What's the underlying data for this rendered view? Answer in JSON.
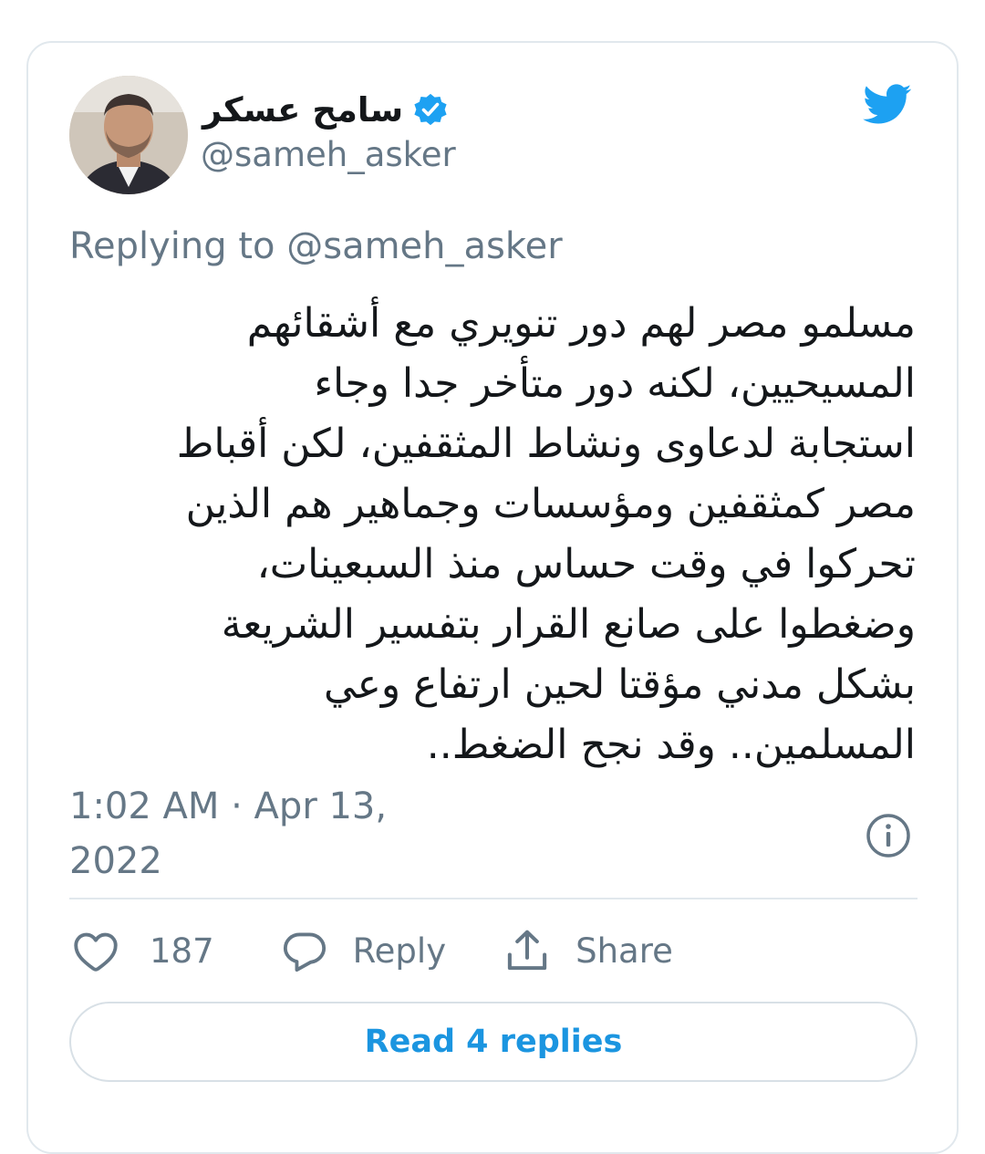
{
  "author": {
    "display_name": "سامح عسكر",
    "handle": "@sameh_asker",
    "verified": true
  },
  "logo_icon": "twitter-bird-icon",
  "replying_to": "Replying to @sameh_asker",
  "tweet_text": "مسلمو مصر لهم دور تنويري مع أشقائهم\nالمسيحيين، لكنه دور متأخر جدا وجاء\nاستجابة لدعاوى ونشاط المثقفين،  لكن أقباط\nمصر كمثقفين ومؤسسات وجماهير هم الذين\nتحركوا في وقت حساس منذ السبعينات،\nوضغطوا على صانع القرار بتفسير الشريعة\nبشكل مدني مؤقتا لحين ارتفاع وعي\nالمسلمين.. وقد نجح الضغط..",
  "timestamp": "1:02 AM · Apr 13, 2022",
  "actions": {
    "likes_count": "187",
    "reply_label": "Reply",
    "share_label": "Share"
  },
  "read_replies_label": "Read 4 replies",
  "colors": {
    "twitter_blue": "#1da1f2",
    "link_blue": "#1b95e0",
    "text_primary": "#14171a",
    "text_secondary": "#657786",
    "border": "#e1e8ed"
  }
}
